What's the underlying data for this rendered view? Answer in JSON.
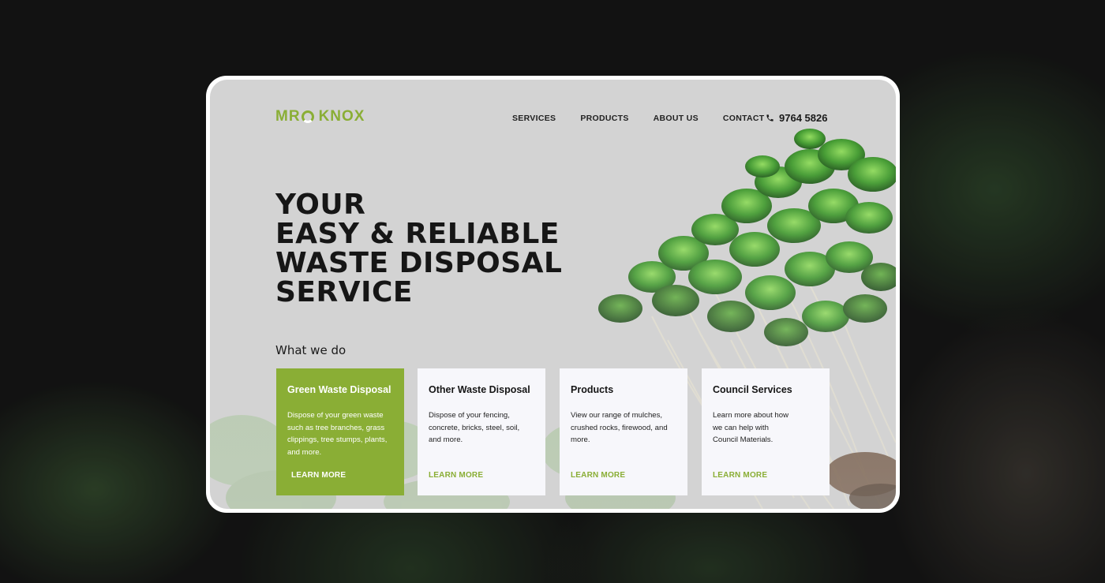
{
  "brand": {
    "logo_left": "MR",
    "logo_right": "KNOX"
  },
  "nav": {
    "items": [
      "SERVICES",
      "PRODUCTS",
      "ABOUT US",
      "CONTACT"
    ],
    "phone": "9764 5826",
    "phone_icon": "phone-icon"
  },
  "hero": {
    "line1": "YOUR",
    "line2": "EASY & RELIABLE",
    "line3": "WASTE DISPOSAL",
    "line4": "SERVICE"
  },
  "section": {
    "label": "What we do"
  },
  "cards": [
    {
      "title": "Green Waste Disposal",
      "desc": "Dispose of your green waste such as tree branches, grass clippings, tree stumps, plants, and more.",
      "link": "LEARN MORE"
    },
    {
      "title": "Other Waste Disposal",
      "desc": "Dispose of your fencing, concrete, bricks, steel, soil, and more.",
      "link": "LEARN MORE"
    },
    {
      "title": "Products",
      "desc": "View our range of mulches, crushed rocks, firewood, and more.",
      "link": "LEARN MORE"
    },
    {
      "title": "Council Services",
      "desc": "Learn more about how we can help with Council Materials.",
      "link": "LEARN MORE"
    }
  ],
  "colors": {
    "accent": "#8aae35",
    "page_bg": "#d3d3d3",
    "card_bg": "#f7f7fb",
    "outer_bg": "#141414"
  }
}
